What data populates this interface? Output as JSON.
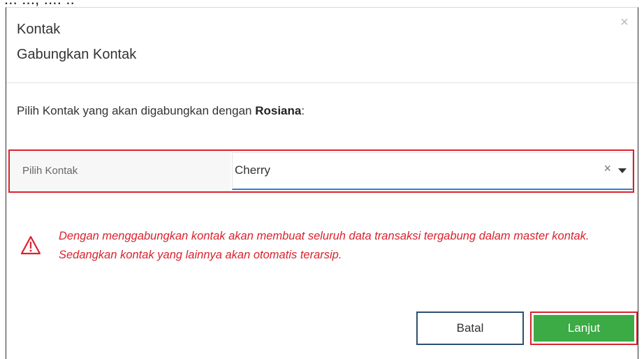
{
  "background_text": "...  ..., ....      ..",
  "modal": {
    "module_title": "Kontak",
    "dialog_title": "Gabungkan Kontak",
    "close_glyph": "×",
    "instruction_prefix": "Pilih Kontak yang akan digabungkan dengan ",
    "instruction_contact": "Rosiana",
    "instruction_suffix": ":",
    "field": {
      "label": "Pilih Kontak",
      "value": "Cherry",
      "clear_glyph": "×"
    },
    "warning": {
      "icon": "warning-triangle-icon",
      "text": "Dengan menggabungkan kontak akan membuat seluruh data transaksi tergabung dalam master kontak. Sedangkan kontak yang lainnya akan otomatis terarsip."
    },
    "buttons": {
      "cancel": "Batal",
      "next": "Lanjut"
    }
  },
  "colors": {
    "highlight": "#d9232d",
    "primary_button": "#3caa45",
    "warning_text": "#d9232d",
    "focus_underline": "#2f7fd9"
  }
}
